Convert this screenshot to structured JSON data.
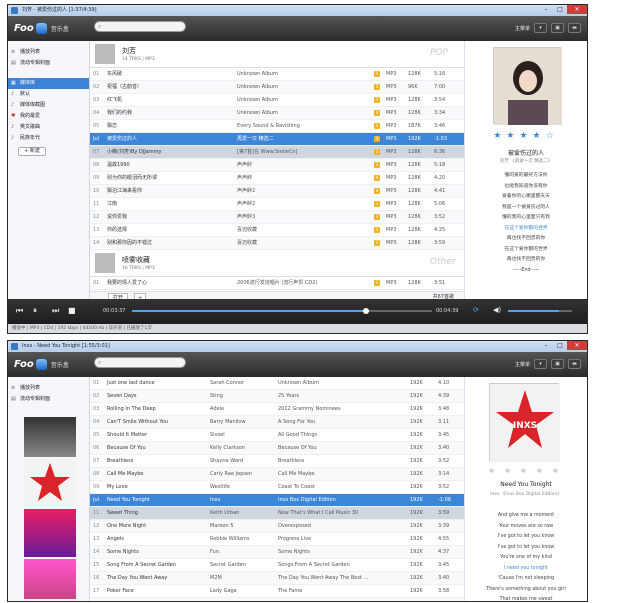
{
  "w1": {
    "title": "刘芳 - 被爱伤过的人 [1:37/4:39]",
    "app_name": "音乐盒",
    "menu": "主菜单",
    "sidebar": [
      {
        "label": "播放列表",
        "icon": "list-icon"
      },
      {
        "label": "流动专辑封面",
        "icon": "album-icon"
      },
      {
        "label": "媒体库",
        "icon": "library-icon"
      },
      {
        "label": "默认",
        "icon": "note-icon"
      },
      {
        "label": "媒体库截图",
        "icon": "note-icon"
      },
      {
        "label": "我的最爱",
        "icon": "heart-icon"
      },
      {
        "label": "英文歌曲",
        "icon": "note-icon"
      },
      {
        "label": "民族年代",
        "icon": "note-icon"
      }
    ],
    "new_label": "+ 新建",
    "groups": [
      {
        "name": "刘芳",
        "sub": "14 TRKS | MP3",
        "tag": "POP"
      },
      {
        "name": "喷雾收藏",
        "sub": "16 TRKS | MP3",
        "tag": "Other"
      }
    ],
    "rows": [
      {
        "n": "01",
        "t": "东风破",
        "a": "Unknown Album",
        "q": "5",
        "f": "MP3",
        "k": "128K",
        "d": "5:16"
      },
      {
        "n": "02",
        "t": "祝福（古韵音）",
        "a": "Unknown Album",
        "q": "5",
        "f": "MP3",
        "k": "96K",
        "d": "7:00"
      },
      {
        "n": "03",
        "t": "红飞机",
        "a": "Unknown Album",
        "q": "5",
        "f": "MP3",
        "k": "128K",
        "d": "3:54"
      },
      {
        "n": "04",
        "t": "我们的约我",
        "a": "Unknown Album",
        "q": "4",
        "f": "MP3",
        "k": "128K",
        "d": "3:34"
      },
      {
        "n": "05",
        "t": "飘恋",
        "a": "Every Sound & Ravishing",
        "q": "4",
        "f": "MP3",
        "k": "187K",
        "d": "3:46"
      },
      {
        "n": "Jul",
        "t": "被爱伤过的人",
        "a": "再爱一次 精选二",
        "q": "4",
        "f": "MP3",
        "k": "192K",
        "d": "-1:03"
      },
      {
        "n": "07",
        "t": "小薇(刘芳)By DJJammy",
        "a": "[第7首]在 Www.SmileCn]",
        "q": "3",
        "f": "MP3",
        "k": "128K",
        "d": "6:36"
      },
      {
        "n": "08",
        "t": "温故1990",
        "a": "声声醉",
        "q": "3",
        "f": "MP3",
        "k": "128K",
        "d": "5:18"
      },
      {
        "n": "09",
        "t": "别为你的眼泪而无所谓",
        "a": "声声醉",
        "q": "4",
        "f": "MP3",
        "k": "128K",
        "d": "4:20"
      },
      {
        "n": "10",
        "t": "飘泊江海来看你",
        "a": "声声醉2",
        "q": "4",
        "f": "MP3",
        "k": "128K",
        "d": "4:41"
      },
      {
        "n": "11",
        "t": "江南",
        "a": "声声醉2",
        "q": "3",
        "f": "MP3",
        "k": "128K",
        "d": "5:06"
      },
      {
        "n": "12",
        "t": "说你爱我",
        "a": "声声醉3",
        "q": "3",
        "f": "MP3",
        "k": "128K",
        "d": "3:52"
      },
      {
        "n": "13",
        "t": "你的选择",
        "a": "喜迈收藏",
        "q": "3",
        "f": "MP3",
        "k": "128K",
        "d": "4:25"
      },
      {
        "n": "14",
        "t": "别和那你因的不错过",
        "a": "喜迈收藏",
        "q": "3",
        "f": "MP3",
        "k": "128K",
        "d": "3:59"
      }
    ],
    "rows2": [
      {
        "n": "01",
        "t": "我要的情人爱了心",
        "a": "2006流行发烧唱片 (流行声贯 CD2)",
        "q": "3",
        "f": "MP3",
        "k": "128K",
        "d": "3:51"
      }
    ],
    "footer_open": "打开",
    "footer_add": "+",
    "footer_count": "共67首歌",
    "time_cur": "00:03:37",
    "time_end": "00:04:39",
    "progress": 0.78,
    "volume": 0.8,
    "status": "播放中 | MP3 | CD4 | 192 kbps | 44100 Hz | 双声道 | 已播放了1次",
    "now_title": "被爱伤过的人",
    "now_sub": "刘芳 《再爱一次 精选二》",
    "lyrics": [
      "懂的爱的最好方法你",
      "也能我知道你没有你",
      "爱着你的心哪里都天天",
      "我是一个被爱伤过的人",
      "懂的我的心里面只有我",
      "在这个爱你都的世界",
      "再也找不回曾的你",
      "在这个爱你都的世界",
      "再也找不回曾的你",
      "-----End-----"
    ],
    "lyric_highlight": 5
  },
  "w2": {
    "title": "Inxs - Need You Tonight [1:55/3:01]",
    "app_name": "音乐盒",
    "menu": "主菜单",
    "sidebar": [
      {
        "label": "播放列表",
        "icon": "list-icon"
      },
      {
        "label": "流动专辑封面",
        "icon": "album-icon"
      }
    ],
    "rows": [
      {
        "n": "01",
        "t": "Just one last dance",
        "a": "Sarah Connor",
        "b": "Unknown Album",
        "k": "192K",
        "d": "4:10"
      },
      {
        "n": "02",
        "t": "Seven Days",
        "a": "Sting",
        "b": "25 Years",
        "k": "192K",
        "d": "4:39"
      },
      {
        "n": "03",
        "t": "Rolling In The Deep",
        "a": "Adele",
        "b": "2012 Grammy Nominees",
        "k": "192K",
        "d": "3:48"
      },
      {
        "n": "04",
        "t": "Can'T Smile Without You",
        "a": "Barry Manilow",
        "b": "A Song For You",
        "k": "192K",
        "d": "3:11"
      },
      {
        "n": "05",
        "t": "Should It Matter",
        "a": "Sixsel",
        "b": "All Good Things",
        "k": "192K",
        "d": "3:45"
      },
      {
        "n": "06",
        "t": "Because Of You",
        "a": "Kelly Clarkson",
        "b": "Because Of You",
        "k": "192K",
        "d": "3:40"
      },
      {
        "n": "07",
        "t": "Breathless",
        "a": "Shayne Ward",
        "b": "Breathless",
        "k": "192K",
        "d": "3:52"
      },
      {
        "n": "08",
        "t": "Call Me Maybe",
        "a": "Carly Rae Jepsen",
        "b": "Call Me Maybe",
        "k": "192K",
        "d": "3:14"
      },
      {
        "n": "09",
        "t": "My Love",
        "a": "Westlife",
        "b": "Coast To Coast",
        "k": "192K",
        "d": "3:52"
      },
      {
        "n": "Jul",
        "t": "Need You Tonight",
        "a": "Inxs",
        "b": "Inxs Box Digital Edition",
        "k": "192K",
        "d": "-1:06"
      },
      {
        "n": "11",
        "t": "Sweet Thing",
        "a": "Keith Urban",
        "b": "Now That's What I Call Music 30",
        "k": "192K",
        "d": "3:59"
      },
      {
        "n": "12",
        "t": "One More Night",
        "a": "Maroon 5",
        "b": "Overexposed",
        "k": "192K",
        "d": "3:39"
      },
      {
        "n": "13",
        "t": "Angels",
        "a": "Robbie Williams",
        "b": "Progress Live",
        "k": "192K",
        "d": "4:55"
      },
      {
        "n": "14",
        "t": "Some Nights",
        "a": "Fun.",
        "b": "Some Nights",
        "k": "192K",
        "d": "4:37"
      },
      {
        "n": "15",
        "t": "Song From A Secret Garden",
        "a": "Secret Garden",
        "b": "Songs From A Secret Garden",
        "k": "192K",
        "d": "3:45"
      },
      {
        "n": "16",
        "t": "The Day You Went Away",
        "a": "M2M",
        "b": "The Day You Went Away The Best ...",
        "k": "192K",
        "d": "3:40"
      },
      {
        "n": "17",
        "t": "Poker Face",
        "a": "Lady Gaga",
        "b": "The Fame",
        "k": "192K",
        "d": "3:58"
      },
      {
        "n": "18",
        "t": "The Tide Is High",
        "a": "Atomic Kitten",
        "b": "Feels So Good",
        "k": "192K",
        "d": "3:28"
      }
    ],
    "now_title": "Need You Tonight",
    "now_sub": "Inxs 《Inxs Box Digital Edition》",
    "lyrics": [
      "And give me a moment",
      "Your moves are so raw",
      "I've got to let you know",
      "I've got to let you know",
      "You're one of my kind",
      "I need you tonight",
      "'Cause I'm not sleeping",
      "There's something about you girl",
      "That makes me sweat"
    ],
    "lyric_highlight": 5
  }
}
